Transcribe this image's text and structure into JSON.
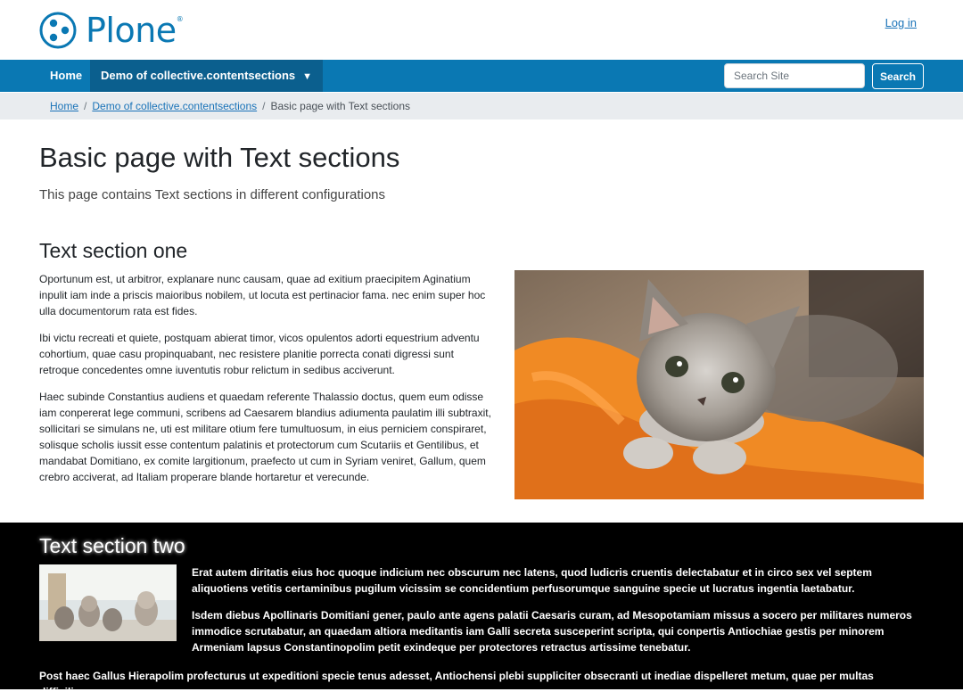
{
  "header": {
    "logo_text": "Plone",
    "logo_reg": "®",
    "login_label": "Log in"
  },
  "navbar": {
    "items": [
      {
        "label": "Home"
      },
      {
        "label": "Demo of collective.contentsections"
      }
    ],
    "dropdown_caret": "▼",
    "search_placeholder": "Search Site",
    "search_button_label": "Search"
  },
  "breadcrumb": {
    "items": [
      "Home",
      "Demo of collective.contentsections",
      "Basic page with Text sections"
    ],
    "separator": "/"
  },
  "page": {
    "title": "Basic page with Text sections",
    "description": "This page contains Text sections in different configurations"
  },
  "section_one": {
    "title": "Text section one",
    "paragraphs": [
      "Oportunum est, ut arbitror, explanare nunc causam, quae ad exitium praecipitem Aginatium inpulit iam inde a priscis maioribus nobilem, ut locuta est pertinacior fama. nec enim super hoc ulla documentorum rata est fides.",
      "Ibi victu recreati et quiete, postquam abierat timor, vicos opulentos adorti equestrium adventu cohortium, quae casu propinquabant, nec resistere planitie porrecta conati digressi sunt retroque concedentes omne iuventutis robur relictum in sedibus acciverunt.",
      "Haec subinde Constantius audiens et quaedam referente Thalassio doctus, quem eum odisse iam conpererat lege communi, scribens ad Caesarem blandius adiumenta paulatim illi subtraxit, sollicitari se simulans ne, uti est militare otium fere tumultuosum, in eius perniciem conspiraret, solisque scholis iussit esse contentum palatinis et protectorum cum Scutariis et Gentilibus, et mandabat Domitiano, ex comite largitionum, praefecto ut cum in Syriam veniret, Gallum, quem crebro acciverat, ad Italiam properare blande hortaretur et verecunde."
    ]
  },
  "section_two": {
    "title": "Text section two",
    "paragraphs": [
      "Erat autem diritatis eius hoc quoque indicium nec obscurum nec latens, quod ludicris cruentis delectabatur et in circo sex vel septem aliquotiens vetitis certaminibus pugilum vicissim se concidentium perfusorumque sanguine specie ut lucratus ingentia laetabatur.",
      "Isdem diebus Apollinaris Domitiani gener, paulo ante agens palatii Caesaris curam, ad Mesopotamiam missus a socero per militares numeros immodice scrutabatur, an quaedam altiora meditantis iam Galli secreta susceperint scripta, qui conpertis Antiochiae gestis per minorem Armeniam lapsus Constantinopolim petit exindeque per protectores retractus artissime tenebatur.",
      "Post haec Gallus Hierapolim profecturus ut expeditioni specie tenus adesset, Antiochensi plebi suppliciter obsecranti ut inediae dispelleret metum, quae per multas difficilisque"
    ]
  },
  "colors": {
    "brand_blue": "#0a78b3",
    "nav_active": "#0b5f8e",
    "link": "#1a73b8",
    "crumb_bg": "#e9ecef"
  }
}
